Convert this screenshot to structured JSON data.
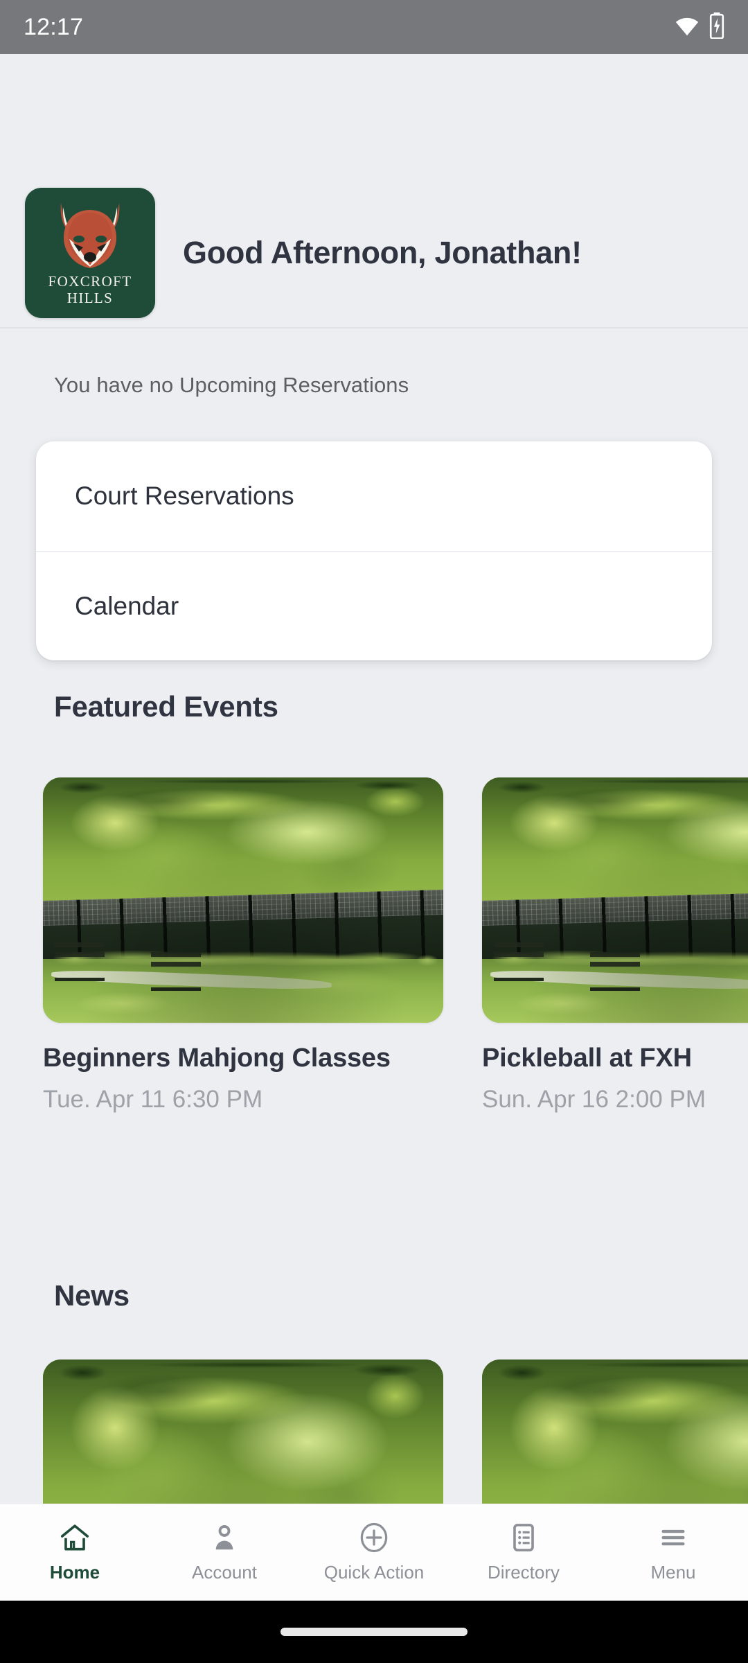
{
  "statusbar": {
    "time": "12:17",
    "wifi_icon": "wifi-icon",
    "battery_icon": "battery-charging-icon"
  },
  "header": {
    "logo": {
      "icon": "fox-head-icon",
      "line1": "FOXCROFT",
      "line2": "HILLS",
      "bg_color": "#1f4c38"
    },
    "greeting": "Good Afternoon, Jonathan!"
  },
  "reservations": {
    "empty_text": "You have no Upcoming Reservations",
    "quick_links": [
      {
        "label": "Court Reservations"
      },
      {
        "label": "Calendar"
      }
    ]
  },
  "featured": {
    "title": "Featured Events",
    "events": [
      {
        "title": "Beginners Mahjong Classes",
        "date": "Tue. Apr 11 6:30 PM",
        "image": "tennis-courts-photo"
      },
      {
        "title": "Pickleball at FXH",
        "date": "Sun. Apr 16 2:00 PM",
        "image": "tennis-courts-photo"
      }
    ]
  },
  "news": {
    "title": "News",
    "items": [
      {
        "image": "tennis-courts-photo"
      },
      {
        "image": "tennis-courts-photo"
      }
    ]
  },
  "bottomnav": {
    "active_color": "#1f4c38",
    "inactive_color": "#8d9096",
    "items": [
      {
        "label": "Home",
        "icon": "home-icon",
        "active": true
      },
      {
        "label": "Account",
        "icon": "person-icon",
        "active": false
      },
      {
        "label": "Quick Action",
        "icon": "plus-circle-icon",
        "active": false
      },
      {
        "label": "Directory",
        "icon": "list-document-icon",
        "active": false
      },
      {
        "label": "Menu",
        "icon": "hamburger-menu-icon",
        "active": false
      }
    ]
  }
}
